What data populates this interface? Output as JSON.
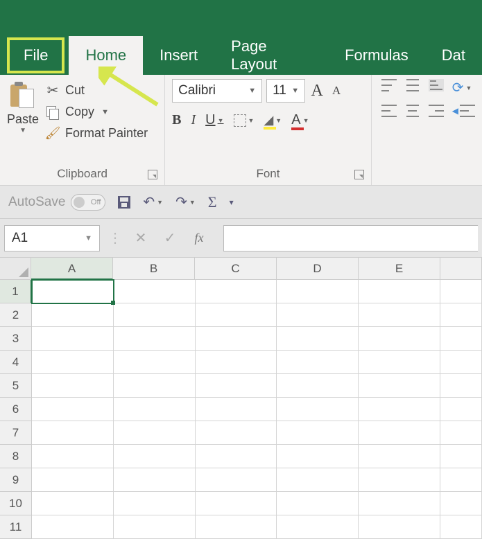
{
  "tabs": {
    "file": "File",
    "home": "Home",
    "insert": "Insert",
    "page_layout": "Page Layout",
    "formulas": "Formulas",
    "data": "Dat"
  },
  "clipboard": {
    "paste": "Paste",
    "cut": "Cut",
    "copy": "Copy",
    "format_painter": "Format Painter",
    "group_label": "Clipboard"
  },
  "font": {
    "name": "Calibri",
    "size": "11",
    "bold": "B",
    "italic": "I",
    "underline": "U",
    "grow": "A",
    "shrink": "A",
    "fontcolor_letter": "A",
    "group_label": "Font"
  },
  "qat": {
    "autosave": "AutoSave",
    "toggle": "Off",
    "sigma": "Σ"
  },
  "namebox": "A1",
  "fx": "fx",
  "columns": [
    "A",
    "B",
    "C",
    "D",
    "E"
  ],
  "rows": [
    "1",
    "2",
    "3",
    "4",
    "5",
    "6",
    "7",
    "8",
    "9",
    "10",
    "11"
  ],
  "active_cell": {
    "row": 0,
    "col": 0
  },
  "colors": {
    "brand": "#217346",
    "highlight": "#d6e64e",
    "fill": "#ffeb3b",
    "fontcolor": "#d32f2f"
  }
}
